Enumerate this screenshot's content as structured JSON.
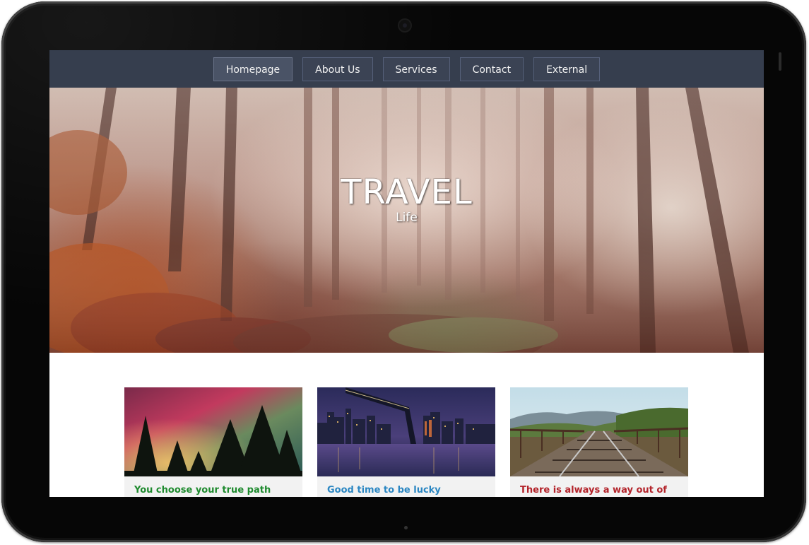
{
  "nav": {
    "items": [
      {
        "label": "Homepage",
        "active": true
      },
      {
        "label": "About Us",
        "active": false
      },
      {
        "label": "Services",
        "active": false
      },
      {
        "label": "Contact",
        "active": false
      },
      {
        "label": "External",
        "active": false
      }
    ]
  },
  "hero": {
    "title": "TRAVEL",
    "subtitle": "Life"
  },
  "cards": [
    {
      "title": "You choose your true path",
      "title_color": "#1e8a2e",
      "image": "aurora-forest"
    },
    {
      "title": "Good time to be lucky",
      "title_color": "#2a86c2",
      "image": "city-bridge-night"
    },
    {
      "title": "There is always a way out of",
      "title_color": "#b3232a",
      "image": "railway-bridge-mountains"
    }
  ],
  "colors": {
    "navbar": "#363e4e",
    "bezel": "#060606"
  }
}
